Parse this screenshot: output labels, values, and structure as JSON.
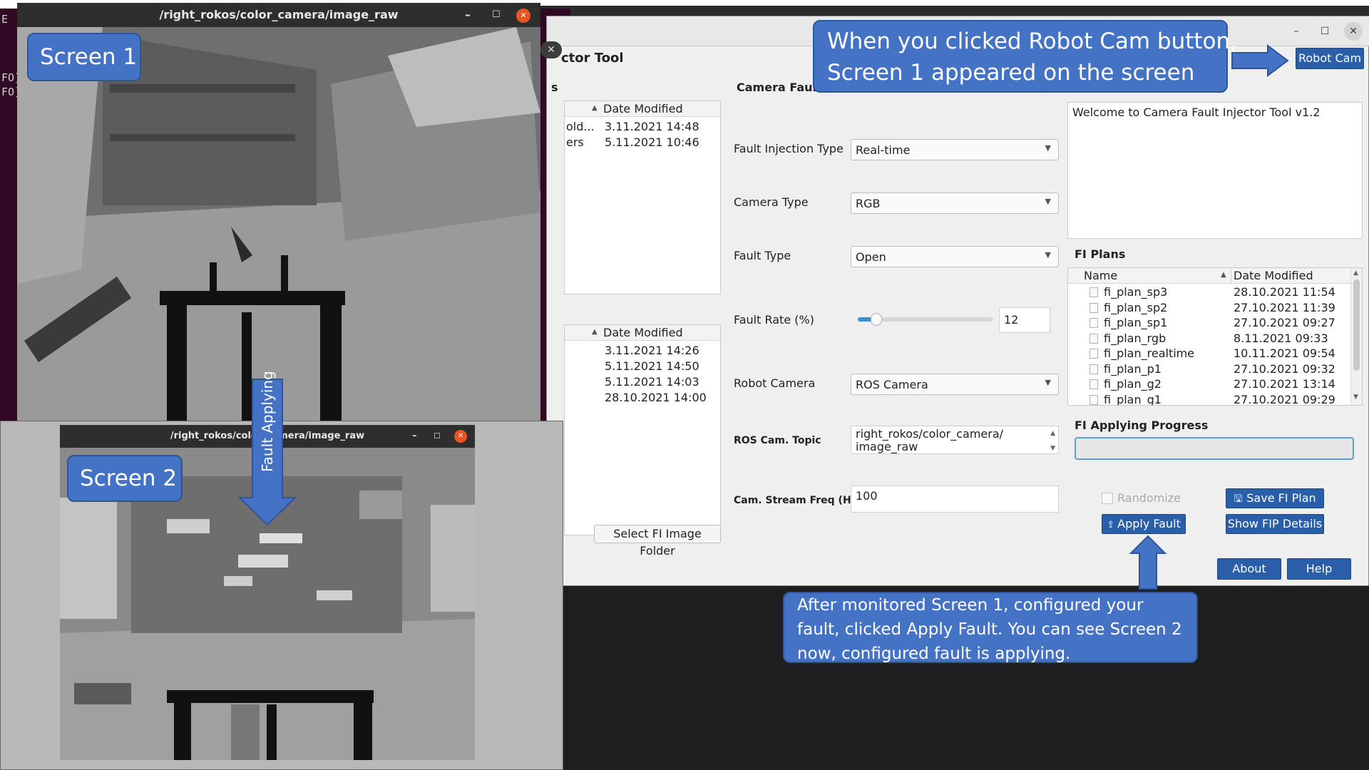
{
  "terminal": {
    "lines": [
      "E",
      "FO]",
      "FO]"
    ]
  },
  "app": {
    "title": "ctor Tool",
    "camera_fault_header": "Camera Fault",
    "s_label": "s",
    "window_controls": {
      "minimize": "–",
      "maximize": "☐",
      "close": "✕"
    },
    "left_tree_top": {
      "date_header": "Date Modified",
      "rows": [
        {
          "name": "old...",
          "date": "3.11.2021 14:48"
        },
        {
          "name": "ers",
          "date": "5.11.2021 10:46"
        }
      ]
    },
    "left_tree_bottom": {
      "date_header": "Date Modified",
      "rows": [
        {
          "date": "3.11.2021 14:26"
        },
        {
          "date": "5.11.2021 14:50"
        },
        {
          "date": "5.11.2021 14:03"
        },
        {
          "date": "28.10.2021 14:00"
        }
      ]
    },
    "select_folder_button": "Select FI Image Folder",
    "form": {
      "fault_injection_type": {
        "label": "Fault Injection Type",
        "value": "Real-time"
      },
      "camera_type": {
        "label": "Camera Type",
        "value": "RGB"
      },
      "fault_type": {
        "label": "Fault Type",
        "value": "Open"
      },
      "fault_rate": {
        "label": "Fault Rate (%)",
        "value": "12",
        "slider_fraction": 0.12
      },
      "robot_camera": {
        "label": "Robot Camera",
        "value": "ROS Camera"
      },
      "ros_cam_topic": {
        "label": "ROS Cam. Topic",
        "line1": "right_rokos/color_camera/",
        "line2": "image_raw"
      },
      "cam_stream_freq": {
        "label": "Cam. Stream Freq (Hz)",
        "value": "100"
      }
    },
    "robot_cam_button": "Robot Cam",
    "log_text": "Welcome to Camera Fault Injector Tool v1.2",
    "fi_plans": {
      "title": "FI Plans",
      "name_header": "Name",
      "date_header": "Date Modified",
      "rows": [
        {
          "name": "fi_plan_sp3",
          "date": "28.10.2021 11:54"
        },
        {
          "name": "fi_plan_sp2",
          "date": "27.10.2021 11:39"
        },
        {
          "name": "fi_plan_sp1",
          "date": "27.10.2021 09:27"
        },
        {
          "name": "fi_plan_rgb",
          "date": "8.11.2021 09:33"
        },
        {
          "name": "fi_plan_realtime",
          "date": "10.11.2021 09:54"
        },
        {
          "name": "fi_plan_p1",
          "date": "27.10.2021 09:32"
        },
        {
          "name": "fi_plan_g2",
          "date": "27.10.2021 13:14"
        },
        {
          "name": "fi_plan_g1",
          "date": "27.10.2021 09:29"
        }
      ]
    },
    "fi_progress": {
      "title": "FI Applying Progress",
      "value": 0
    },
    "randomize_label": "Randomize",
    "save_fi_plan": "Save FI Plan",
    "apply_fault": "Apply Fault",
    "show_fip_details": "Show FIP Details",
    "about": "About",
    "help": "Help"
  },
  "screen1": {
    "title": "/right_rokos/color_camera/image_raw",
    "label": "Screen 1",
    "controls": {
      "minimize": "–",
      "maximize": "☐",
      "close": "✕"
    }
  },
  "screen2": {
    "title": "/right_rokos/color_camera/image_raw",
    "label": "Screen 2",
    "controls": {
      "minimize": "–",
      "maximize": "☐",
      "close": "✕"
    }
  },
  "annotations": {
    "callout_top_line1": "When you clicked Robot Cam button,",
    "callout_top_line2": "Screen 1 appeared on the screen",
    "callout_bottom_line1": "After monitored Screen 1, configured your",
    "callout_bottom_line2": "fault, clicked Apply Fault. You can see Screen 2",
    "callout_bottom_line3": "now, configured fault is applying.",
    "fault_applying_arrow": "Fault Applying"
  },
  "colors": {
    "accent_blue": "#4472c4",
    "button_blue": "#2a5ea8",
    "terminal_bg": "#300a24",
    "close_orange": "#e95420"
  }
}
